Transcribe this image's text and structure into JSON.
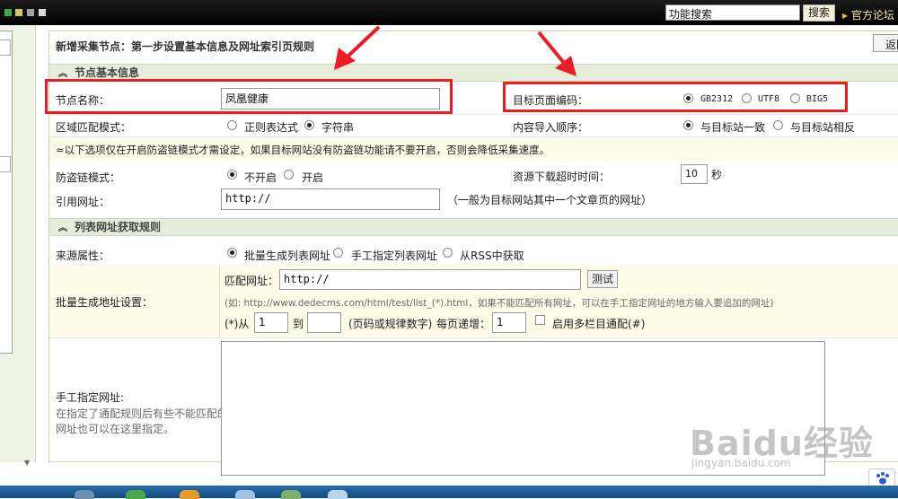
{
  "topbar": {
    "search_value": "功能搜索",
    "search_button": "搜索",
    "forum_link": "官方论坛"
  },
  "page": {
    "title": "新增采集节点：第一步设置基本信息及网址索引页规则",
    "back_button": "返回"
  },
  "section_basic": {
    "header": "节点基本信息",
    "node_name_label": "节点名称：",
    "node_name_value": "凤凰健康",
    "encoding_label": "目标页面编码：",
    "encoding_options": [
      "GB2312",
      "UTF8",
      "BIG5"
    ],
    "encoding_selected": "GB2312",
    "region_mode_label": "区域匹配模式：",
    "region_mode_options": [
      "正则表达式",
      "字符串"
    ],
    "region_mode_selected": "字符串",
    "import_order_label": "内容导入顺序：",
    "import_order_options": [
      "与目标站一致",
      "与目标站相反"
    ],
    "import_order_selected": "与目标站一致",
    "antileech_notice": "≈以下选项仅在开启防盗链模式才需设定，如果目标网站没有防盗链功能请不要开启，否则会降低采集速度。",
    "antileech_label": "防盗链模式：",
    "antileech_options": [
      "不开启",
      "开启"
    ],
    "antileech_selected": "不开启",
    "timeout_label": "资源下载超时时间：",
    "timeout_value": "10",
    "timeout_unit": "秒",
    "referer_label": "引用网址：",
    "referer_value": "http://",
    "referer_hint": "（一般为目标网站其中一个文章页的网址）"
  },
  "section_list": {
    "header": "列表网址获取规则",
    "source_label": "来源属性：",
    "source_options": [
      "批量生成列表网址",
      "手工指定列表网址",
      "从RSS中获取"
    ],
    "source_selected": "批量生成列表网址",
    "batch_label": "批量生成地址设置：",
    "match_url_label": "匹配网址：",
    "match_url_value": "http://",
    "test_button": "测试",
    "example_text": "(如: http://www.dedecms.com/html/test/list_(*).html，如果不能匹配所有网址，可以在手工指定网址的地方输入要追加的网址)",
    "from_label": "(*)从",
    "from_value": "1",
    "to_label": "到",
    "to_value": "",
    "page_hint": "(页码或规律数字)",
    "step_label": "每页递增：",
    "step_value": "1",
    "multi_label": "启用多栏目通配(#)",
    "manual_label": "手工指定网址:",
    "manual_hint_1": "在指定了通配规则后有些不能匹配的",
    "manual_hint_2": "网址也可以在这里指定。",
    "manual_value": ""
  },
  "watermark": {
    "logo": "Baidu经验",
    "url": "jingyan.baidu.com"
  },
  "colors": {
    "annotation_red": "#ec1c24",
    "section_bg": "#e7eddb",
    "topbar_bg": "#000000"
  }
}
